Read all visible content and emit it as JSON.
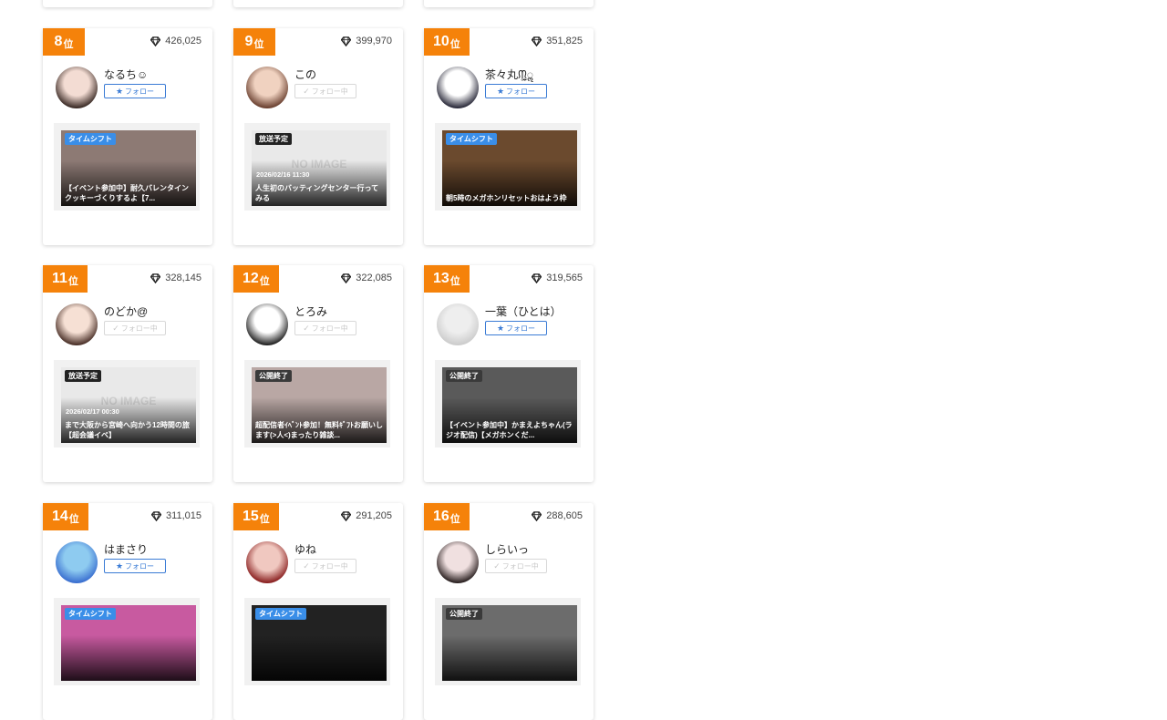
{
  "labels": {
    "rank_suffix": "位",
    "follow": "フォロー",
    "following": "フォロー中",
    "no_image": "NO IMAGE"
  },
  "cards": [
    {
      "rank": "8",
      "points": "426,025",
      "name": "なるち☺",
      "following": false,
      "thumb": {
        "label": "タイムシフト",
        "label_type": "timeshift",
        "date": "",
        "title": "【イベント参加中】耐久バレンタインクッキーづくりするよ【7...",
        "bg": "#8d7a74"
      }
    },
    {
      "rank": "9",
      "points": "399,970",
      "name": "この",
      "following": true,
      "thumb": {
        "label": "放送予定",
        "label_type": "scheduled",
        "date": "2026/02/16 11:30",
        "title": "人生初のバッティングセンター行ってみる",
        "bg": "#e9e9e9",
        "noimage": true
      }
    },
    {
      "rank": "10",
      "points": "351,825",
      "name": "茶々丸ᙏ̤̫͚ॢ",
      "following": false,
      "thumb": {
        "label": "タイムシフト",
        "label_type": "timeshift",
        "date": "",
        "title": "朝5時のメガホンリセットおはよう枠",
        "bg": "#6b4a2e"
      }
    },
    {
      "rank": "11",
      "points": "328,145",
      "name": "のどか@",
      "following": true,
      "thumb": {
        "label": "放送予定",
        "label_type": "scheduled",
        "date": "2026/02/17 00:30",
        "title": "まで大阪から宮崎へ向かう12時間の旅【超会議イベ】",
        "bg": "#e9e9e9",
        "noimage": true
      }
    },
    {
      "rank": "12",
      "points": "322,085",
      "name": "とろみ",
      "following": true,
      "thumb": {
        "label": "公開終了",
        "label_type": "ended",
        "date": "",
        "title": "超配信者ｲﾍﾞﾝﾄ参加！無料ｷﾞﾌﾄお願いします(>人<)まったり雑談...",
        "bg": "#b9a7a4"
      }
    },
    {
      "rank": "13",
      "points": "319,565",
      "name": "一葉（ひとは）",
      "following": false,
      "thumb": {
        "label": "公開終了",
        "label_type": "ended",
        "date": "",
        "title": "【イベント参加中】かまえよちゃん(ラジオ配信)【メガホンくだ...",
        "bg": "#5a5a5a"
      }
    },
    {
      "rank": "14",
      "points": "311,015",
      "name": "はまさり",
      "following": false,
      "thumb": {
        "label": "タイムシフト",
        "label_type": "timeshift",
        "date": "",
        "title": "",
        "bg": "#c85aa0"
      }
    },
    {
      "rank": "15",
      "points": "291,205",
      "name": "ゆね",
      "following": true,
      "thumb": {
        "label": "タイムシフト",
        "label_type": "timeshift",
        "date": "",
        "title": "",
        "bg": "#222222"
      }
    },
    {
      "rank": "16",
      "points": "288,605",
      "name": "しらいっ",
      "following": true,
      "thumb": {
        "label": "公開終了",
        "label_type": "ended",
        "date": "",
        "title": "",
        "bg": "#6c6c6c"
      }
    }
  ],
  "colors": {
    "rank_badge": "#f5820a",
    "follow_blue": "#3a7bd5",
    "timeshift_label": "#3a8ee8"
  }
}
